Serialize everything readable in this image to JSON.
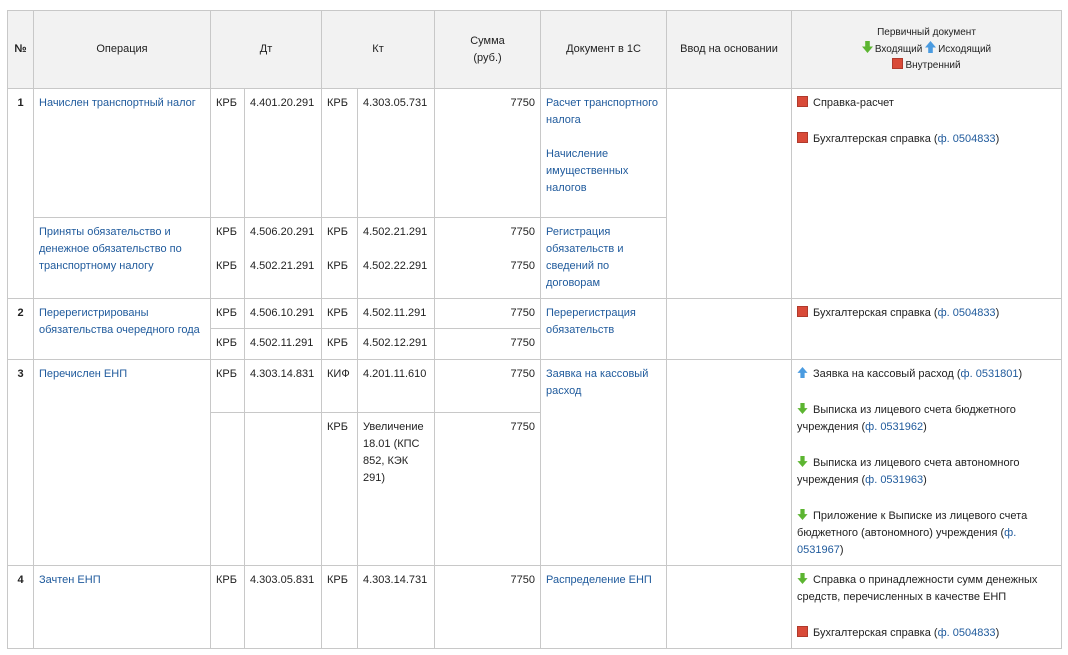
{
  "header": {
    "num": "№",
    "operation": "Операция",
    "dt": "Дт",
    "kt": "Кт",
    "sum_line1": "Сумма",
    "sum_line2": "(руб.)",
    "doc1c": "Документ в 1С",
    "basis": "Ввод на основании",
    "primary": "Первичный документ",
    "legend_incoming": "Входящий",
    "legend_outgoing": "Исходящий",
    "legend_internal": "Внутренний"
  },
  "rows": [
    {
      "num": "1",
      "op_a": "Начислен транспортный налог",
      "dt_a_code": "КРБ",
      "dt_a_acc": "4.401.20.291",
      "kt_a_code": "КРБ",
      "kt_a_acc": "4.303.05.731",
      "sum_a": "7750",
      "doc_a1": "Расчет транспортного налога",
      "doc_a2": "Начисление имущественных налогов",
      "op_b": "Приняты обязательство и денежное обязательство по транспортному налогу",
      "dt_b1_code": "КРБ",
      "dt_b1_acc": "4.506.20.291",
      "dt_b2_code": "КРБ",
      "dt_b2_acc": "4.502.21.291",
      "kt_b1_code": "КРБ",
      "kt_b1_acc": "4.502.21.291",
      "kt_b2_code": "КРБ",
      "kt_b2_acc": "4.502.22.291",
      "sum_b1": "7750",
      "sum_b2": "7750",
      "doc_b": "Регистрация обязательств и сведений по договорам",
      "primary_1": "Справка-расчет",
      "primary_2_text": "Бухгалтерская справка (",
      "primary_2_link": "ф. 0504833",
      "primary_2_tail": ")"
    },
    {
      "num": "2",
      "op": "Перерегистрированы обязательства очередного года",
      "dt_1_code": "КРБ",
      "dt_1_acc": "4.506.10.291",
      "kt_1_code": "КРБ",
      "kt_1_acc": "4.502.11.291",
      "sum_1": "7750",
      "dt_2_code": "КРБ",
      "dt_2_acc": "4.502.11.291",
      "kt_2_code": "КРБ",
      "kt_2_acc": "4.502.12.291",
      "sum_2": "7750",
      "doc": "Перерегистрация обязательств",
      "primary_text": "Бухгалтерская справка (",
      "primary_link": "ф. 0504833",
      "primary_tail": ")"
    },
    {
      "num": "3",
      "op": "Перечислен ЕНП",
      "dt_1_code": "КРБ",
      "dt_1_acc": "4.303.14.831",
      "kt_1_code": "КИФ",
      "kt_1_acc": "4.201.11.610",
      "sum_1": "7750",
      "kt_2_code": "КРБ",
      "kt_2_acc": "Увеличение 18.01 (КПС 852, КЭК 291)",
      "sum_2": "7750",
      "doc": "Заявка на кассовый расход",
      "p1_text": "Заявка на кассовый расход (",
      "p1_link": "ф. 0531801",
      "p1_tail": ")",
      "p2_text": "Выписка из лицевого счета бюджетного учреждения (",
      "p2_link": "ф. 0531962",
      "p2_tail": ")",
      "p3_text": "Выписка из лицевого счета автономного учреждения (",
      "p3_link": "ф. 0531963",
      "p3_tail": ")",
      "p4_text": "Приложение к Выписке из лицевого счета бюджетного (автономного) учреждения (",
      "p4_link": "ф. 0531967",
      "p4_tail": ")"
    },
    {
      "num": "4",
      "op": "Зачтен ЕНП",
      "dt_code": "КРБ",
      "dt_acc": "4.303.05.831",
      "kt_code": "КРБ",
      "kt_acc": "4.303.14.731",
      "sum": "7750",
      "doc": "Распределение ЕНП",
      "p1_text": "Справка о принадлежности сумм денежных средств, перечисленных в качестве ЕНП",
      "p2_text": "Бухгалтерская справка (",
      "p2_link": "ф. 0504833",
      "p2_tail": ")"
    }
  ],
  "colors": {
    "link": "#1f5a9c",
    "incoming": "#5cb531",
    "outgoing": "#4a9be0",
    "internal": "#d94a38"
  }
}
